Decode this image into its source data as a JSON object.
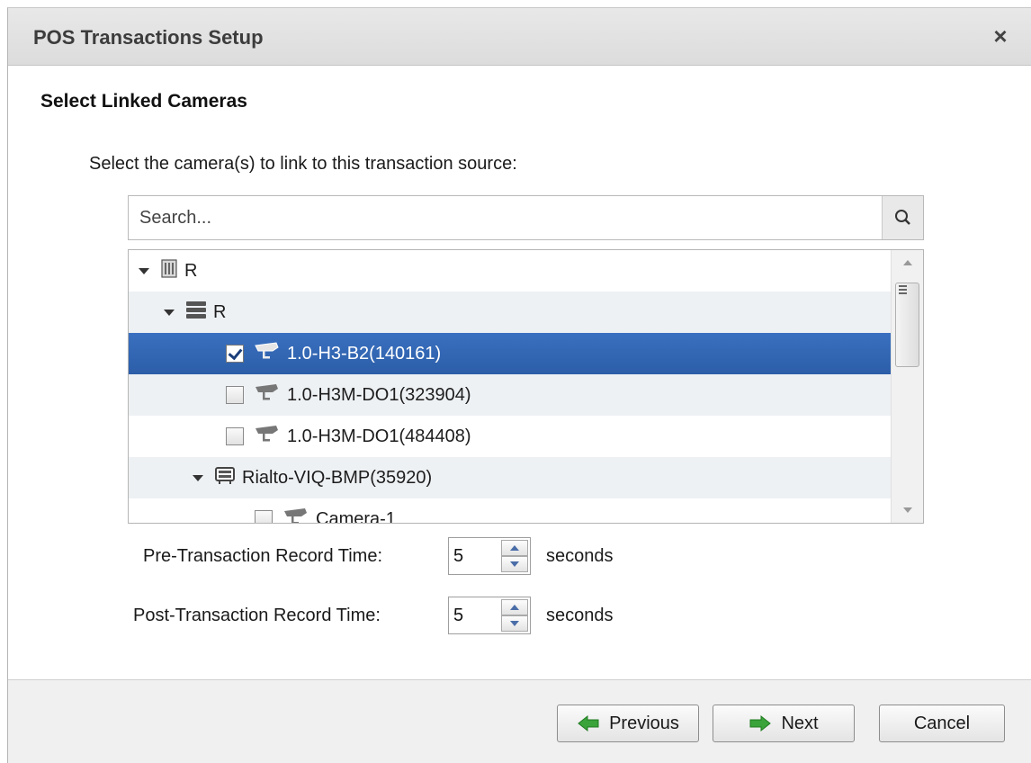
{
  "dialog": {
    "title": "POS Transactions Setup",
    "close_glyph": "×"
  },
  "section": {
    "title": "Select Linked Cameras",
    "instruction": "Select the camera(s) to link to this transaction source:"
  },
  "search": {
    "placeholder": "Search..."
  },
  "tree": [
    {
      "label": "R",
      "icon": "site-icon",
      "expanded": true,
      "checkbox": false,
      "checked": false,
      "selected": false
    },
    {
      "label": "R",
      "icon": "server-icon",
      "expanded": true,
      "checkbox": false,
      "checked": false,
      "selected": false
    },
    {
      "label": "1.0-H3-B2(140161)",
      "icon": "camera-icon",
      "checkbox": true,
      "checked": true,
      "selected": true
    },
    {
      "label": "1.0-H3M-DO1(323904)",
      "icon": "camera-icon",
      "checkbox": true,
      "checked": false,
      "selected": false
    },
    {
      "label": "1.0-H3M-DO1(484408)",
      "icon": "camera-icon",
      "checkbox": true,
      "checked": false,
      "selected": false
    },
    {
      "label": "Rialto-VIQ-BMP(35920)",
      "icon": "appliance-icon",
      "expanded": true,
      "checkbox": false,
      "checked": false,
      "selected": false
    },
    {
      "label": "Camera-1",
      "icon": "camera-icon",
      "checkbox": true,
      "checked": false,
      "selected": false
    }
  ],
  "record_times": {
    "pre": {
      "label": "Pre-Transaction Record Time:",
      "value": "5",
      "unit": "seconds"
    },
    "post": {
      "label": "Post-Transaction Record Time:",
      "value": "5",
      "unit": "seconds"
    }
  },
  "buttons": {
    "previous": "Previous",
    "next": "Next",
    "cancel": "Cancel"
  },
  "colors": {
    "selection": "#2f63ae",
    "arrow_green": "#3aa33a"
  }
}
